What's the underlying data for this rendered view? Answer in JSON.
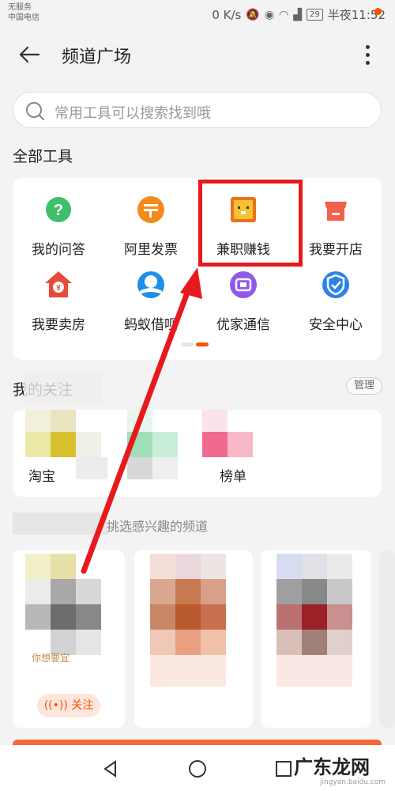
{
  "status": {
    "carrier_line1": "无服务",
    "carrier_line2": "中国电信",
    "net_speed": "0 K/s",
    "battery": "29",
    "time": "半夜11:52"
  },
  "header": {
    "title": "频道广场"
  },
  "search": {
    "placeholder": "常用工具可以搜索找到哦"
  },
  "tools_section": {
    "title": "全部工具",
    "items": [
      {
        "label": "我的问答",
        "icon": "question-icon",
        "color": "#3fbf6a"
      },
      {
        "label": "阿里发票",
        "icon": "ticket-icon",
        "color": "#f28a1c"
      },
      {
        "label": "兼职赚钱",
        "icon": "lion-icon",
        "color": "#f0a020"
      },
      {
        "label": "我要开店",
        "icon": "store-icon",
        "color": "#f0604a"
      },
      {
        "label": "我要卖房",
        "icon": "house-icon",
        "color": "#e84a3a"
      },
      {
        "label": "蚂蚁借呗",
        "icon": "ant-loan-icon",
        "color": "#1e8fe8"
      },
      {
        "label": "优家通信",
        "icon": "sim-card-icon",
        "color": "#8e5ae8"
      },
      {
        "label": "安全中心",
        "icon": "shield-icon",
        "color": "#2a84e8"
      }
    ]
  },
  "follow_section": {
    "title": "我的关注",
    "manage_label": "管理",
    "items": [
      {
        "label": "淘宝"
      },
      {
        "label": "榜单"
      }
    ]
  },
  "recommend_section": {
    "title": "挑选感兴趣的频道",
    "cards": [
      {
        "desc": "你想要宜",
        "follow_label": "关注"
      }
    ]
  },
  "watermark": {
    "text": "广东龙网",
    "sub": "jingyan.baidu.com"
  },
  "colors": {
    "accent": "#ff5000",
    "highlight_box": "#e8191c"
  }
}
